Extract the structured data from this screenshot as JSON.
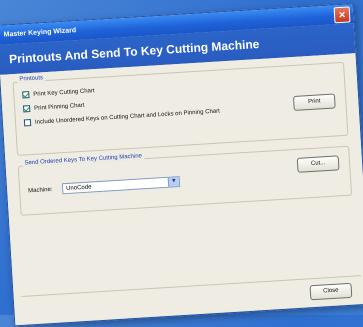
{
  "window": {
    "title": "Master Keying Wizard",
    "close_icon": "close-icon",
    "close_glyph": "✕"
  },
  "header": {
    "title": "Printouts And Send To Key Cutting Machine"
  },
  "printouts": {
    "legend": "Printouts",
    "options": [
      {
        "label": "Print Key Cutting Chart",
        "checked": true
      },
      {
        "label": "Print Pinning Chart",
        "checked": true
      },
      {
        "label": "Include Unordered Keys on Cutting Chart and Locks on Pinning Chart",
        "checked": false
      }
    ],
    "print_button": "Print"
  },
  "send": {
    "legend": "Send Ordered Keys To Key Cutting Machine",
    "machine_label": "Machine:",
    "machine_value": "UnoCode",
    "cut_button": "Cut..."
  },
  "footer": {
    "close_button": "Close"
  },
  "colors": {
    "titlebar": "#1f63d9",
    "header": "#2a5cc0",
    "legend_text": "#1a3fae",
    "desktop": "#3d7fd8"
  }
}
